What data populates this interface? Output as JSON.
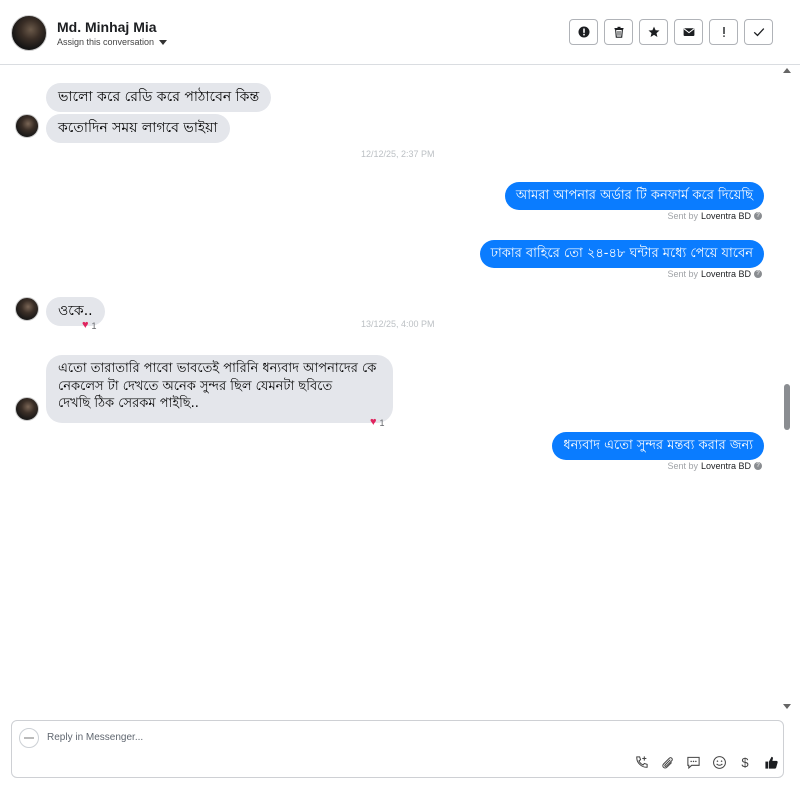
{
  "header": {
    "contact_name": "Md. Minhaj Mia",
    "assign_label": "Assign this conversation",
    "actions": [
      "spam",
      "delete",
      "star",
      "mark-unread",
      "follow-up",
      "done"
    ]
  },
  "messages": [
    {
      "dir": "in",
      "text": "ভালো করে রেডি করে পাঠাবেন কিন্ত"
    },
    {
      "dir": "in",
      "text": "কতোদিন সময় লাগবে ভাইয়া"
    },
    {
      "timestamp": "12/12/25, 2:37 PM"
    },
    {
      "dir": "out",
      "text": "আমরা আপনার অর্ডার টি কনফার্ম করে দিয়েছি",
      "sent_by_prefix": "Sent by",
      "sent_by": "Loventra BD"
    },
    {
      "dir": "out",
      "text": "ঢাকার বাহিরে তো ২৪-৪৮ ঘন্টার মধ্যে পেয়ে যাবেন",
      "sent_by_prefix": "Sent by",
      "sent_by": "Loventra BD"
    },
    {
      "dir": "in",
      "text": "ওকে..",
      "reaction_count": "1"
    },
    {
      "timestamp": "13/12/25, 4:00 PM"
    },
    {
      "dir": "in",
      "lines": [
        "এতো তারাতারি পাবো ভাবতেই পারিনি ধন্যবাদ আপনাদের কে",
        "নেকলেস টা দেখতে অনেক সুন্দর ছিল যেমনটা ছবিতে",
        "দেখছি ঠিক সেরকম পাইছি.."
      ],
      "reaction_count": "1"
    },
    {
      "dir": "out",
      "text": "ধন্যবাদ এতো সুন্দর মন্তব্য করার জন্য",
      "sent_by_prefix": "Sent by",
      "sent_by": "Loventra BD"
    }
  ],
  "composer": {
    "placeholder": "Reply in Messenger...",
    "tools": [
      "call-icon",
      "attachment-icon",
      "saved-reply-icon",
      "emoji-icon",
      "payment-icon",
      "like-icon"
    ],
    "payment_symbol": "$"
  },
  "colors": {
    "outgoing": "#0a7cff",
    "incoming": "#e4e6eb"
  }
}
